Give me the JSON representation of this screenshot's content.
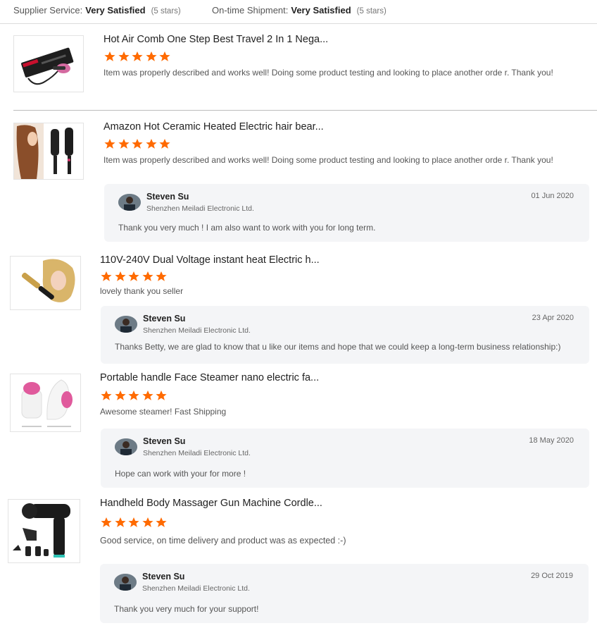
{
  "summary": {
    "supplier_service_label": "Supplier Service:",
    "supplier_service_value": "Very Satisfied",
    "supplier_service_stars": "(5 stars)",
    "shipment_label": "On-time Shipment:",
    "shipment_value": "Very Satisfied",
    "shipment_stars": "(5 stars)"
  },
  "colors": {
    "star": "#ff6a00",
    "reply_bg": "#f4f5f7"
  },
  "reviews": [
    {
      "title": "Hot Air Comb One Step Best Travel 2 In 1 Nega...",
      "rating": 5,
      "image_icon": "hair-dryer-brush-product-icon",
      "text": "Item was properly described and works well! Doing some product testing and looking to place another orde r. Thank you!"
    },
    {
      "title": "Amazon Hot Ceramic Heated Electric hair bear...",
      "rating": 5,
      "image_icon": "hair-straightener-brush-product-icon",
      "text": "Item was properly described and works well! Doing some product testing and looking to place another orde r. Thank you!",
      "reply": {
        "name": "Steven Su",
        "company": "Shenzhen Meiladi Electronic Ltd.",
        "date": "01 Jun 2020",
        "text": "Thank you very much ! I am also want to work with you for long term."
      }
    },
    {
      "title": "110V-240V Dual Voltage instant heat Electric h...",
      "rating": 5,
      "image_icon": "curling-comb-product-icon",
      "text": "lovely thank you seller",
      "reply": {
        "name": "Steven Su",
        "company": "Shenzhen Meiladi Electronic Ltd.",
        "date": "23 Apr 2020",
        "text": "Thanks Betty, we are glad to know that u like our items and hope that  we could keep a long-term business relationship:)"
      }
    },
    {
      "title": "Portable handle Face Steamer nano electric fa...",
      "rating": 5,
      "image_icon": "face-steamer-product-icon",
      "text": "Awesome steamer! Fast Shipping",
      "reply": {
        "name": "Steven Su",
        "company": "Shenzhen Meiladi Electronic Ltd.",
        "date": "18 May 2020",
        "text": "Hope can work with your for more !"
      }
    },
    {
      "title": "Handheld Body Massager Gun Machine Cordle...",
      "rating": 5,
      "image_icon": "massage-gun-product-icon",
      "text": "Good service, on time delivery and product was as expected :-)",
      "reply": {
        "name": "Steven Su",
        "company": "Shenzhen Meiladi Electronic Ltd.",
        "date": "29 Oct 2019",
        "text": "Thank you very much for your support!"
      }
    }
  ]
}
